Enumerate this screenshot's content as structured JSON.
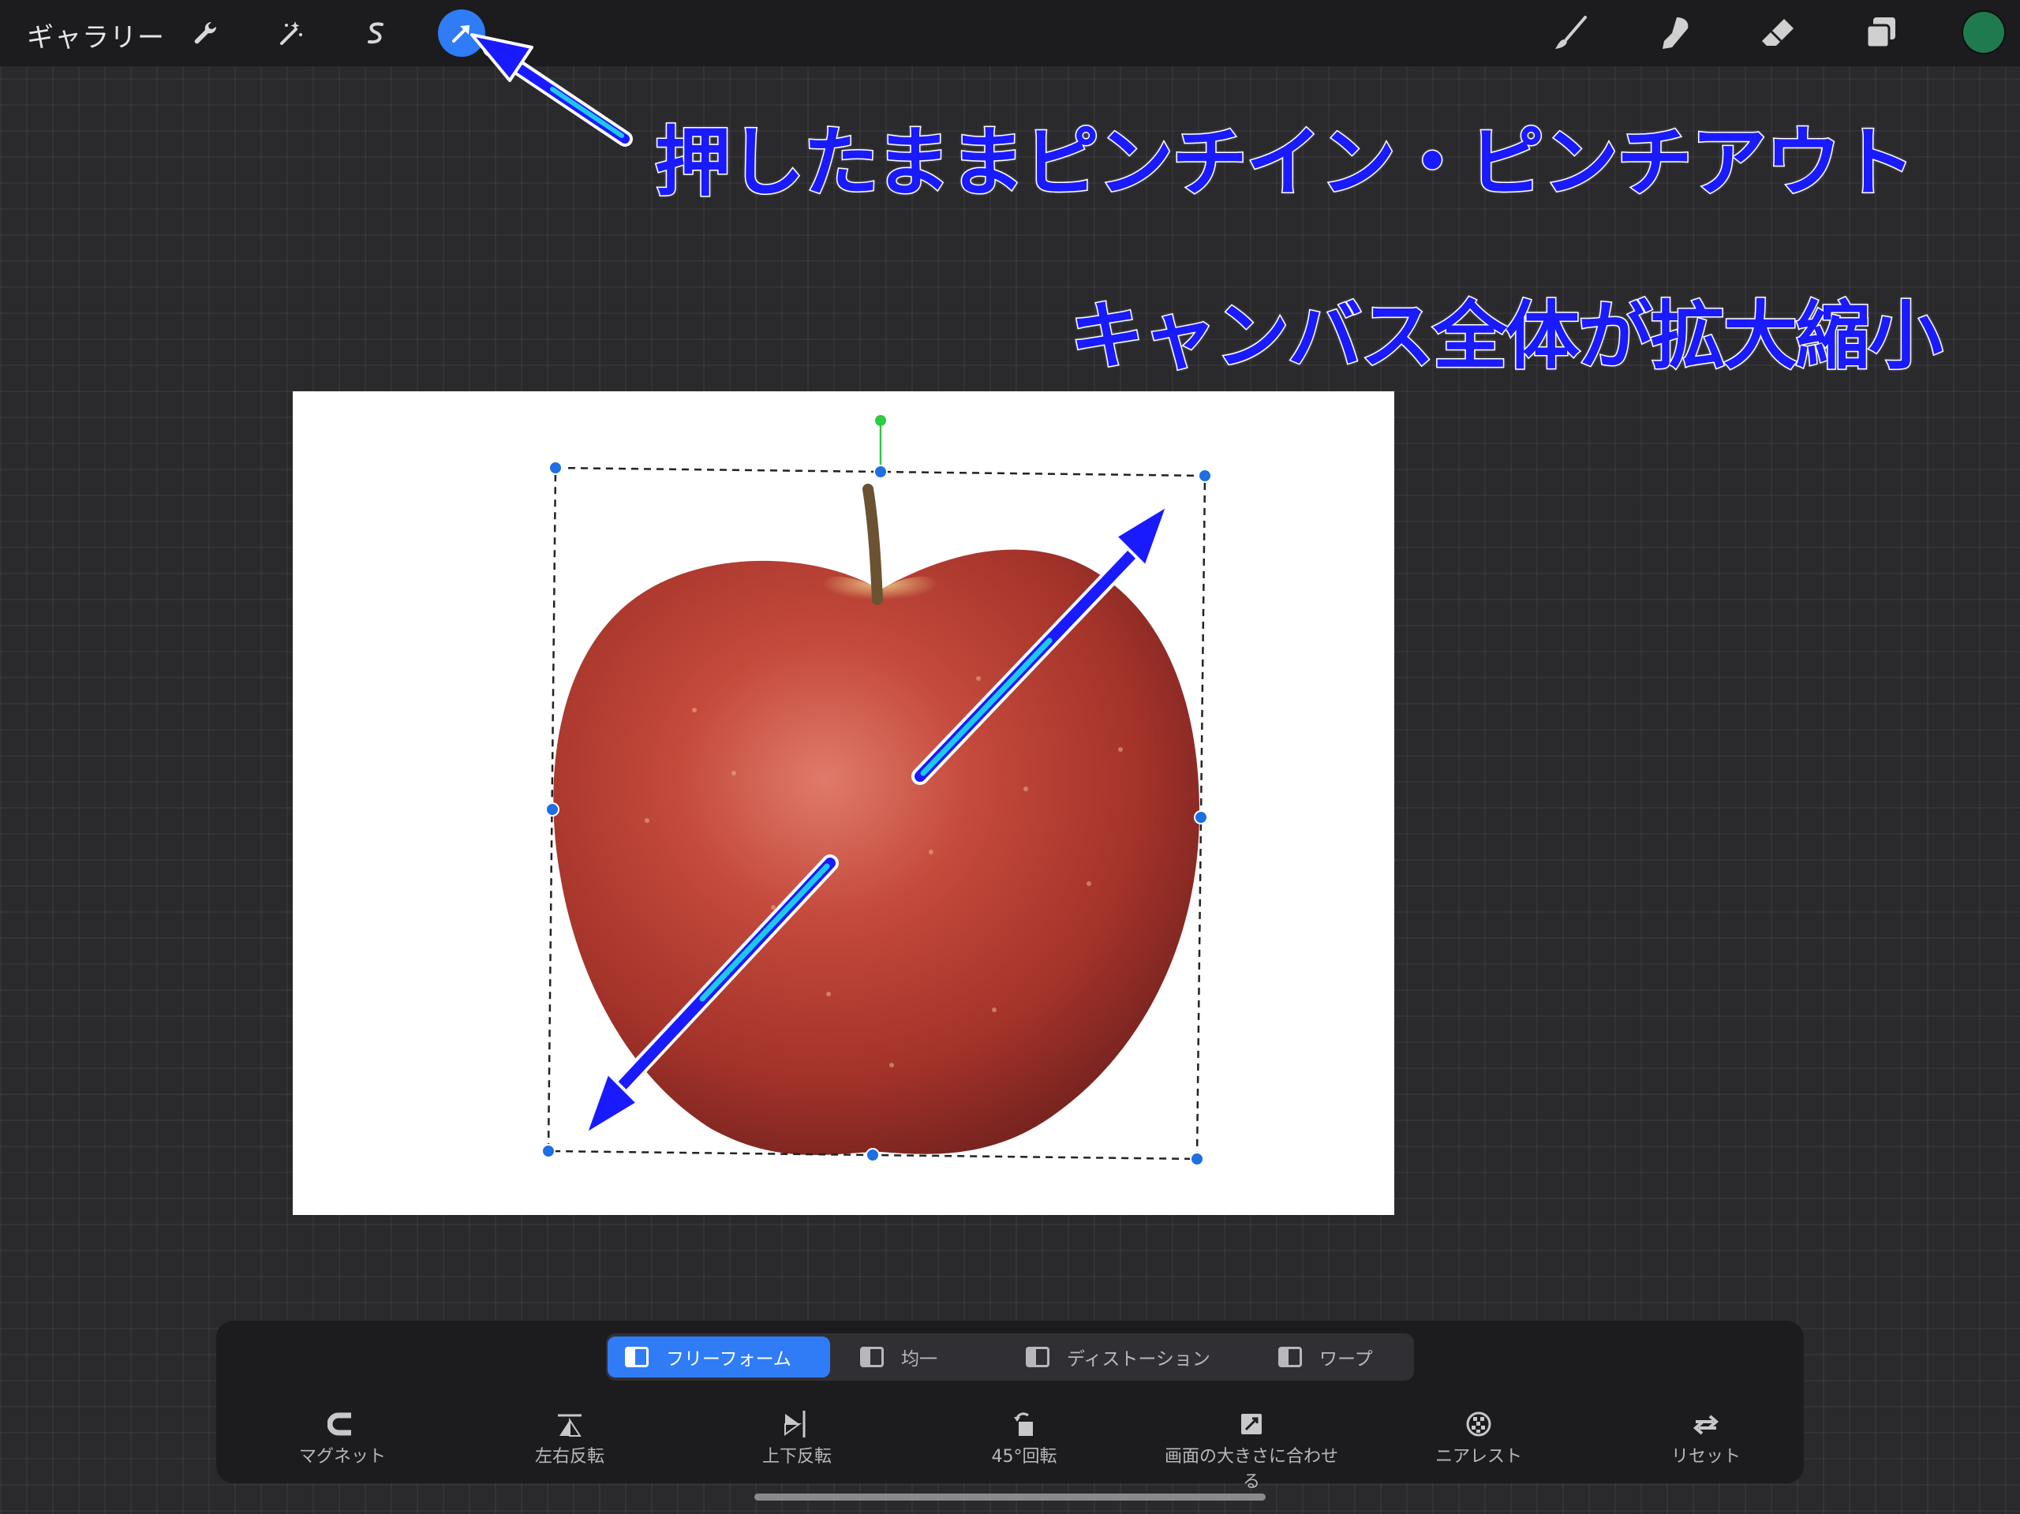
{
  "topbar": {
    "gallery_label": "ギャラリー",
    "left_tools": [
      {
        "name": "adjustments",
        "icon": "wrench-icon"
      },
      {
        "name": "adjustments-magic",
        "icon": "magic-wand-icon"
      },
      {
        "name": "selection",
        "icon": "selection-s-icon"
      },
      {
        "name": "transform",
        "icon": "transform-arrow-icon",
        "active": true
      }
    ],
    "right_tools": [
      {
        "name": "brush",
        "icon": "brush-icon"
      },
      {
        "name": "smudge",
        "icon": "smudge-icon"
      },
      {
        "name": "eraser",
        "icon": "eraser-icon"
      },
      {
        "name": "layers",
        "icon": "layers-icon"
      }
    ],
    "current_color": "#1f7a4f"
  },
  "annotations": {
    "line1": "押したままピンチイン・ピンチアウト",
    "line2": "キャンバス全体が拡大縮小"
  },
  "colors": {
    "accent": "#2f7cf6",
    "annotation_text": "#1a1aff",
    "arrow_inner": "#1ec8e8",
    "rotation_handle": "#2ecc40"
  },
  "transform_panel": {
    "modes": [
      {
        "label": "フリーフォーム",
        "active": true
      },
      {
        "label": "均一",
        "active": false
      },
      {
        "label": "ディストーション",
        "active": false
      },
      {
        "label": "ワープ",
        "active": false
      }
    ],
    "actions": [
      {
        "label": "マグネット",
        "icon": "magnet-icon"
      },
      {
        "label": "左右反転",
        "icon": "flip-horizontal-icon"
      },
      {
        "label": "上下反転",
        "icon": "flip-vertical-icon"
      },
      {
        "label": "45°回転",
        "icon": "rotate-45-icon"
      },
      {
        "label": "画面の大きさに合わせる",
        "icon": "fit-to-screen-icon"
      },
      {
        "label": "ニアレスト",
        "icon": "nearest-icon"
      },
      {
        "label": "リセット",
        "icon": "reset-icon"
      }
    ]
  }
}
